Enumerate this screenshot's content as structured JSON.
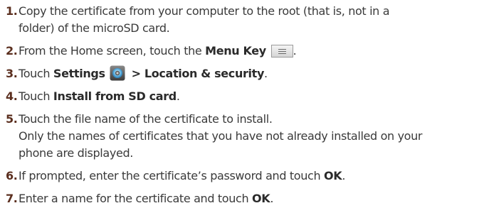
{
  "steps": [
    {
      "num": "1.",
      "lines": [
        "Copy the certificate from your computer to the root (that is, not in a",
        "folder) of the microSD card."
      ]
    },
    {
      "num": "2.",
      "text_before": "From the Home screen, touch the ",
      "bold": "Menu Key",
      "text_after": ".",
      "icon": "menu-key-icon"
    },
    {
      "num": "3.",
      "text_before": "Touch ",
      "bold": "Settings",
      "bold_after": " > Location & security",
      "text_after": ".",
      "icon": "settings-gear-icon"
    },
    {
      "num": "4.",
      "text_before": "Touch ",
      "bold": "Install from SD card",
      "text_after": "."
    },
    {
      "num": "5.",
      "lines": [
        "Touch the file name of the certificate to install.",
        "Only the names of certificates that you have not already installed on your",
        "phone are displayed."
      ]
    },
    {
      "num": "6.",
      "text_before": "If prompted, enter the certificate’s password and touch ",
      "bold": "OK",
      "text_after": "."
    },
    {
      "num": "7.",
      "text_before": "Enter a name for the certificate and touch ",
      "bold": "OK",
      "text_after": "."
    }
  ],
  "colors": {
    "text": "#3a3a3a",
    "number": "#5b2f1f",
    "icon_blue": "#4a9fd0"
  }
}
